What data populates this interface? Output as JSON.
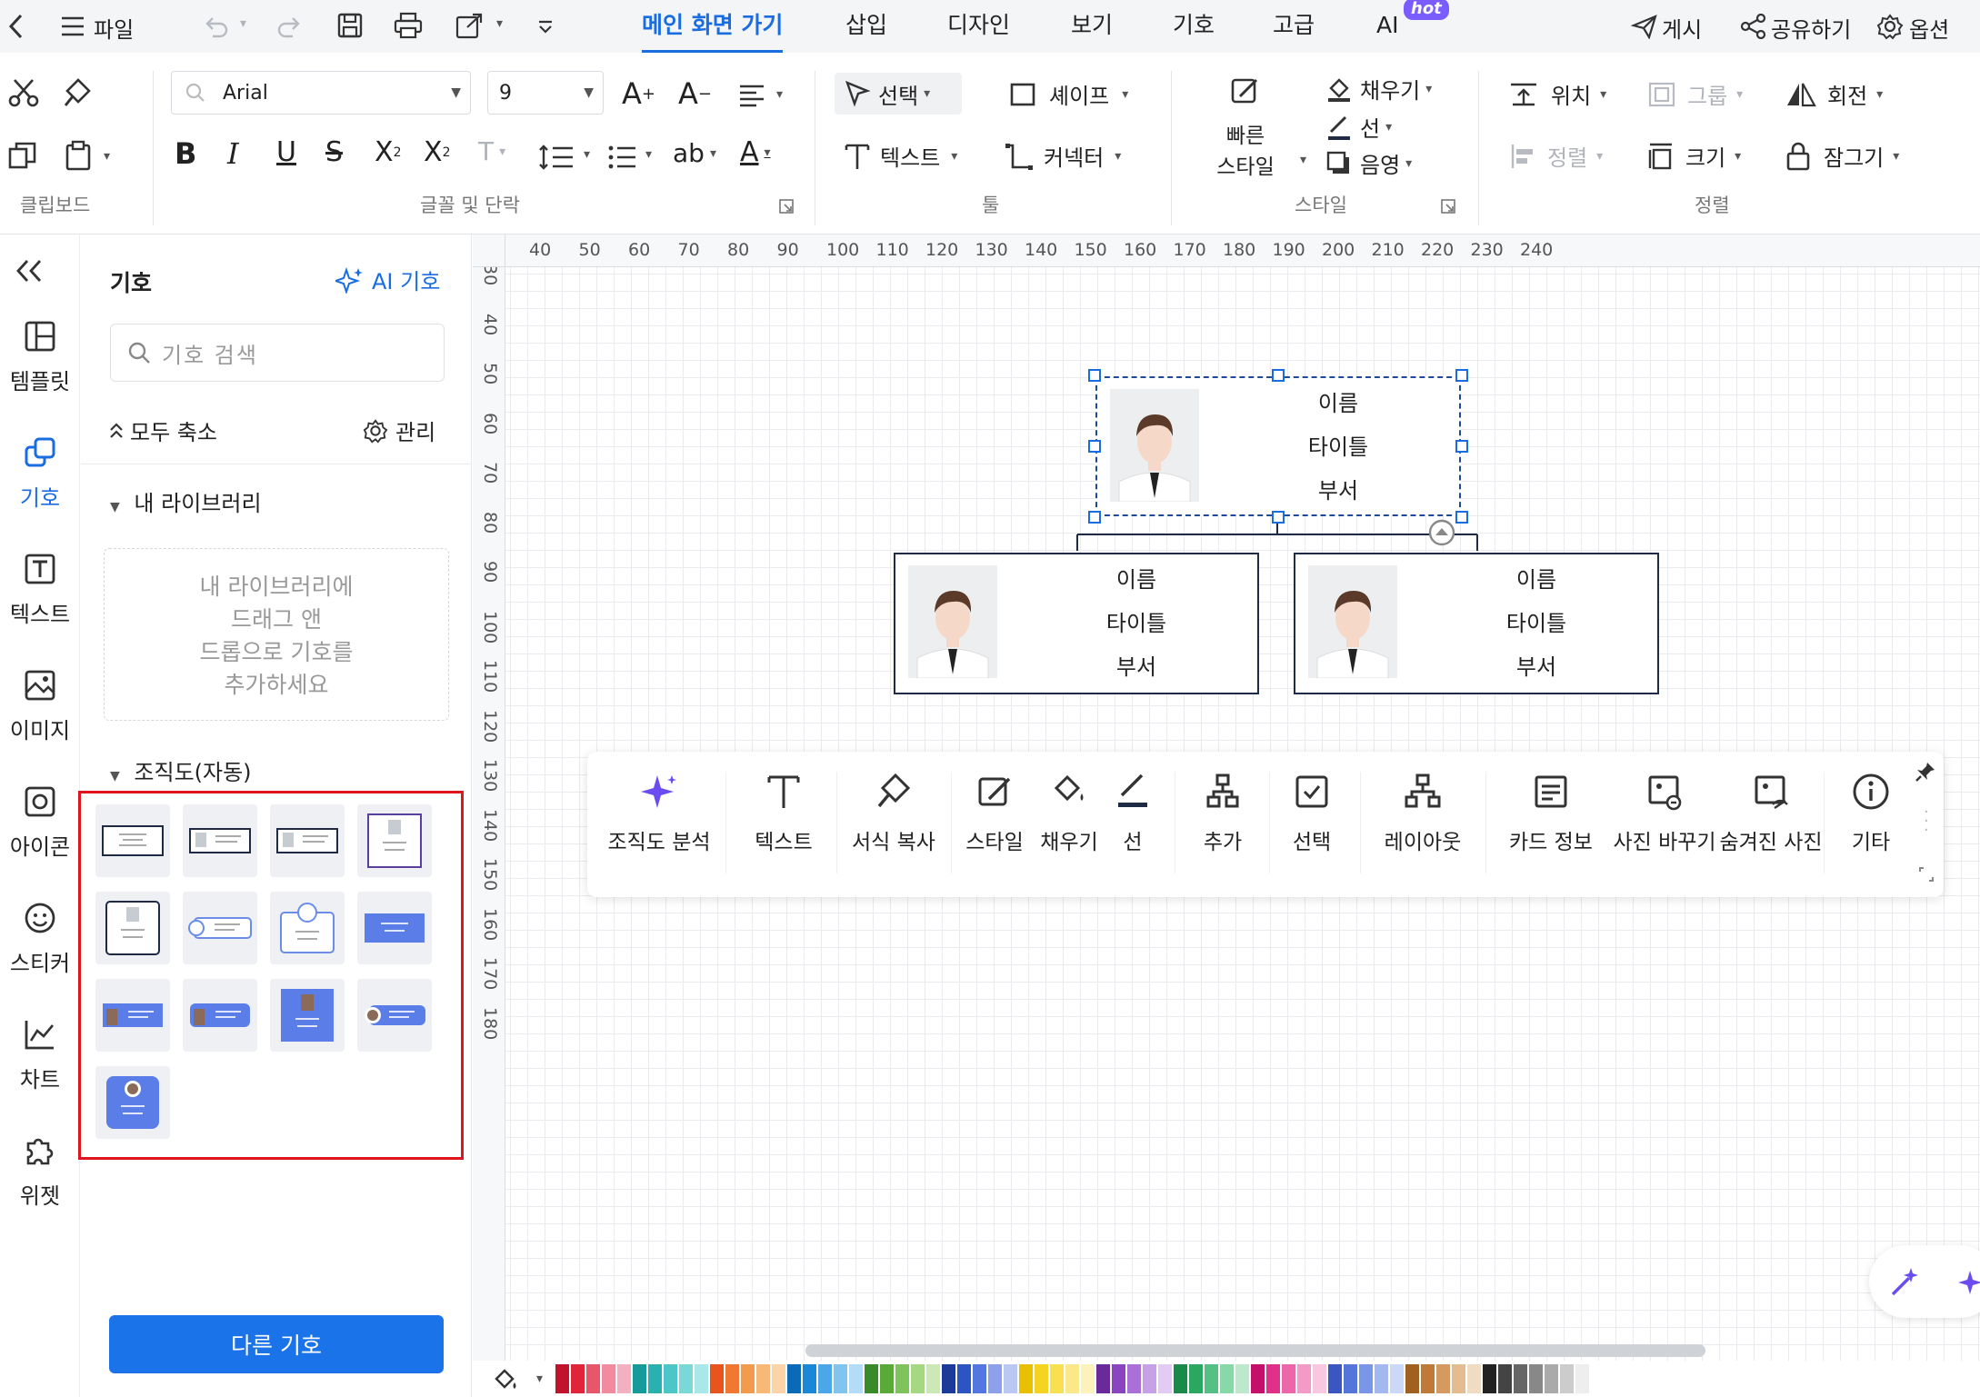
{
  "menubar": {
    "file_label": "파일",
    "tabs": [
      "메인 화면 가기",
      "삽입",
      "디자인",
      "보기",
      "기호",
      "고급",
      "AI"
    ],
    "hot_badge": "hot",
    "publish_label": "게시",
    "share_label": "공유하기",
    "options_label": "옵션"
  },
  "ribbon": {
    "font_name": "Arial",
    "font_size": "9",
    "select_label": "선택",
    "shape_label": "셰이프",
    "text_label": "텍스트",
    "connector_label": "커넥터",
    "quick_style_label_1": "빠른",
    "quick_style_label_2": "스타일",
    "fill_label": "채우기",
    "line_label": "선",
    "shadow_label": "음영",
    "position_label": "위치",
    "group_label": "그룹",
    "rotate_label": "회전",
    "align_label": "정렬",
    "size_label": "크기",
    "lock_label": "잠그기",
    "groups": {
      "clipboard": "클립보드",
      "font_para": "글꼴 및 단락",
      "tools": "툴",
      "style": "스타일",
      "arrange": "정렬"
    }
  },
  "rail": {
    "items": [
      "템플릿",
      "기호",
      "텍스트",
      "이미지",
      "아이콘",
      "스티커",
      "차트",
      "위젯"
    ]
  },
  "panel": {
    "title": "기호",
    "ai_symbol": "AI 기호",
    "search_placeholder": "기호 검색",
    "collapse_all": "모두 축소",
    "manage": "관리",
    "my_library": "내 라이브러리",
    "drop_line1": "내 라이브러리에",
    "drop_line2": "드래그 앤",
    "drop_line3": "드롭으로 기호를",
    "drop_line4": "추가하세요",
    "org_section": "조직도(자동)",
    "other_symbols_button": "다른 기호"
  },
  "ruler": {
    "h": [
      "40",
      "50",
      "60",
      "70",
      "80",
      "90",
      "100",
      "110",
      "120",
      "130",
      "140",
      "150",
      "160",
      "170",
      "180",
      "190",
      "200",
      "210",
      "220",
      "230",
      "240"
    ],
    "v": [
      "30",
      "40",
      "50",
      "60",
      "70",
      "80",
      "90",
      "100",
      "110",
      "120",
      "130",
      "140",
      "150",
      "160",
      "170",
      "180"
    ]
  },
  "cards": [
    {
      "name": "이름",
      "title": "타이틀",
      "dept": "부서"
    },
    {
      "name": "이름",
      "title": "타이틀",
      "dept": "부서"
    },
    {
      "name": "이름",
      "title": "타이틀",
      "dept": "부서"
    }
  ],
  "floatbar": {
    "items": [
      "조직도 분석",
      "텍스트",
      "서식 복사",
      "스타일",
      "채우기",
      "선",
      "추가",
      "선택",
      "레이아웃",
      "카드 정보",
      "사진 바꾸기",
      "숨겨진 사진",
      "기타"
    ]
  },
  "colors": {
    "accent": "#1a6de0",
    "button": "#1a73e8",
    "highlight_box": "#e0141c",
    "card_border": "#1f2b45",
    "palette": [
      "#c0142c",
      "#e0243a",
      "#e8566a",
      "#f28aa0",
      "#f4b0c0",
      "#169a9a",
      "#2bb0b0",
      "#4cc6c6",
      "#7ad8d8",
      "#a8e8e8",
      "#e8541c",
      "#f07830",
      "#f49a4c",
      "#f8b878",
      "#fcd4a8",
      "#0a6ab8",
      "#1a88d8",
      "#4aa8e8",
      "#80c4f0",
      "#b4dcf8",
      "#3a8a2a",
      "#5aaa3a",
      "#7ec45a",
      "#a6d884",
      "#cce8b4",
      "#1c3a9a",
      "#2c54c4",
      "#5476e0",
      "#8ca0ec",
      "#bcc8f4",
      "#e8c000",
      "#f4d420",
      "#f8e050",
      "#fbe888",
      "#fdf2bc",
      "#6a2a9a",
      "#8a44c0",
      "#aa70d8",
      "#c8a0e8",
      "#e2ccf4",
      "#1a8a4a",
      "#2aa860",
      "#54c084",
      "#88d8a8",
      "#bce8cc",
      "#c4106a",
      "#e0308a",
      "#ec66aa",
      "#f49ac8",
      "#f8c8e0",
      "#3a56c0",
      "#5476d8",
      "#7a96e8",
      "#a4b8f0",
      "#ccd8f8",
      "#a06020",
      "#c07a38",
      "#d49a60",
      "#e4bc90",
      "#f0dcc0",
      "#222222",
      "#444444",
      "#666666",
      "#888888",
      "#aaaaaa",
      "#cccccc",
      "#eeeeee"
    ]
  }
}
